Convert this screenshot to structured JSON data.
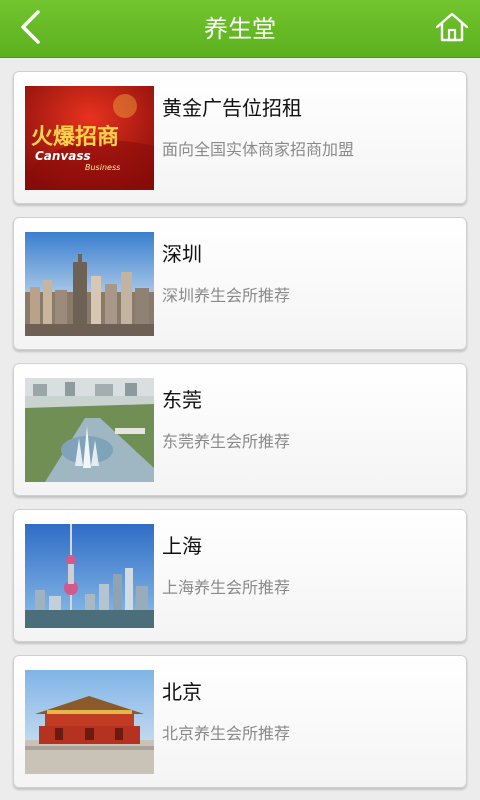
{
  "header": {
    "title": "养生堂",
    "back_icon": "chevron-left-icon",
    "home_icon": "home-icon",
    "bar_color": "#64b924"
  },
  "items": [
    {
      "title": "黄金广告位招租",
      "subtitle": "面向全国实体商家招商加盟",
      "thumbnail": "火爆招商 Canvass Business",
      "thumb_text": "火爆招商"
    },
    {
      "title": "深圳",
      "subtitle": "深圳养生会所推荐",
      "thumbnail": "city-skyline"
    },
    {
      "title": "东莞",
      "subtitle": "东莞养生会所推荐",
      "thumbnail": "city-aerial-fountain"
    },
    {
      "title": "上海",
      "subtitle": "上海养生会所推荐",
      "thumbnail": "pearl-tower-skyline"
    },
    {
      "title": "北京",
      "subtitle": "北京养生会所推荐",
      "thumbnail": "tiananmen"
    }
  ]
}
